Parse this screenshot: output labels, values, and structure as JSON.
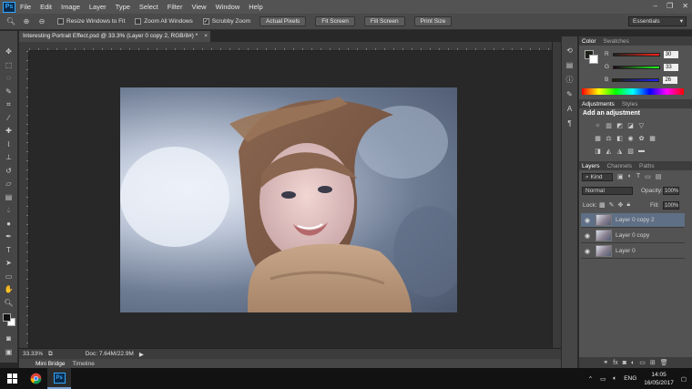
{
  "app": {
    "logo": "Ps"
  },
  "menu": [
    "File",
    "Edit",
    "Image",
    "Layer",
    "Type",
    "Select",
    "Filter",
    "View",
    "Window",
    "Help"
  ],
  "window_controls": [
    "–",
    "❐",
    "✕"
  ],
  "options": {
    "resize_windows": "Resize Windows to Fit",
    "zoom_all": "Zoom All Windows",
    "scrubby": "Scrubby Zoom",
    "actual_pixels": "Actual Pixels",
    "fit_screen": "Fit Screen",
    "fill_screen": "Fill Screen",
    "print_size": "Print Size",
    "workspace": "Essentials"
  },
  "document": {
    "tab_title": "Interesting Portrait Effect.psd @ 33.3% (Layer 0 copy 2, RGB/8#) *",
    "zoom": "33.33%",
    "doc_size": "Doc: 7.64M/22.9M"
  },
  "bottom_tabs": [
    "Mini Bridge",
    "Timeline"
  ],
  "color_panel": {
    "tabs": [
      "Color",
      "Swatches"
    ],
    "r_label": "R",
    "g_label": "G",
    "b_label": "B",
    "r": 30,
    "g": 33,
    "b": 26
  },
  "adjustments_panel": {
    "tabs": [
      "Adjustments",
      "Styles"
    ],
    "title": "Add an adjustment"
  },
  "layers_panel": {
    "tabs": [
      "Layers",
      "Channels",
      "Paths"
    ],
    "kind": "Kind",
    "blend_mode": "Normal",
    "opacity_label": "Opacity:",
    "opacity": "100%",
    "lock_label": "Lock:",
    "fill_label": "Fill:",
    "fill": "100%",
    "layers": [
      {
        "name": "Layer 0 copy 2",
        "selected": true
      },
      {
        "name": "Layer 0 copy",
        "selected": false
      },
      {
        "name": "Layer 0",
        "selected": false
      }
    ]
  },
  "taskbar": {
    "lang": "ENG",
    "time": "14:05",
    "date": "16/05/2017"
  },
  "colors": {
    "accent_selection": "#5f6f85",
    "ps_blue": "#31a8ff",
    "foreground": "#1e211a",
    "background": "#ffffff"
  }
}
